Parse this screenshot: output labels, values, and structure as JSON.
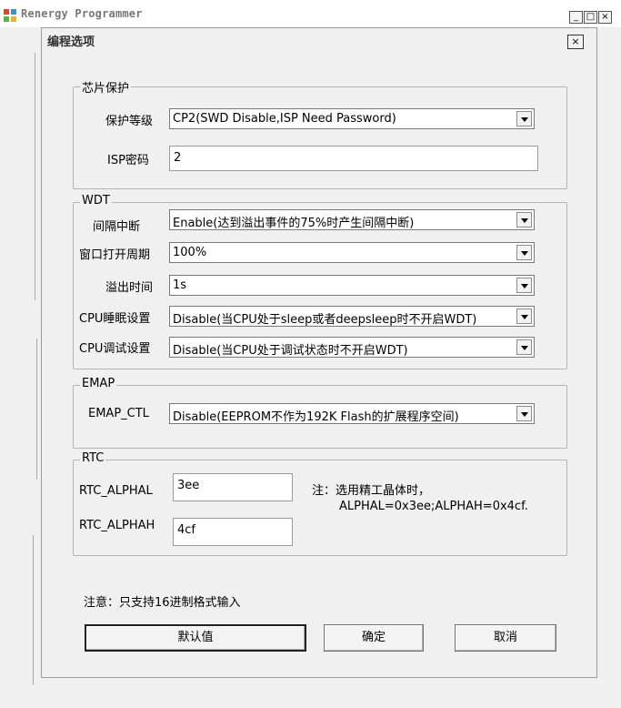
{
  "app": {
    "title": "Renergy Programmer",
    "min_symbol": "_",
    "max_symbol": "□",
    "close_symbol": "×"
  },
  "dialog": {
    "title": "编程选项",
    "close_symbol": "×"
  },
  "chip_protection": {
    "legend": "芯片保护",
    "level_label": "保护等级",
    "level_value": "CP2(SWD Disable,ISP Need Password)",
    "isp_password_label": "ISP密码",
    "isp_password_value": "2"
  },
  "wdt": {
    "legend": "WDT",
    "interval_int_label": "间隔中断",
    "interval_int_value": "Enable(达到溢出事件的75%时产生间隔中断)",
    "window_open_label": "窗口打开周期",
    "window_open_value": "100%",
    "overflow_time_label": "溢出时间",
    "overflow_time_value": "1s",
    "cpu_sleep_label": "CPU睡眠设置",
    "cpu_sleep_value": "Disable(当CPU处于sleep或者deepsleep时不开启WDT)",
    "cpu_debug_label": "CPU调试设置",
    "cpu_debug_value": "Disable(当CPU处于调试状态时不开启WDT)"
  },
  "emap": {
    "legend": "EMAP",
    "ctl_label": "EMAP_CTL",
    "ctl_value": "Disable(EEPROM不作为192K Flash的扩展程序空间)"
  },
  "rtc": {
    "legend": "RTC",
    "alphal_label": "RTC_ALPHAL",
    "alphal_value": "3ee",
    "alphah_label": "RTC_ALPHAH",
    "alphah_value": "4cf",
    "note_line1": "注：选用精工晶体时，",
    "note_line2": "ALPHAL=0x3ee;ALPHAH=0x4cf."
  },
  "footer": {
    "note": "注意：只支持16进制格式输入",
    "default_button": "默认值",
    "ok_button": "确定",
    "cancel_button": "取消"
  },
  "icons": {
    "app_icon": "app-logo-icon",
    "dropdown": "chevron-down-icon"
  }
}
